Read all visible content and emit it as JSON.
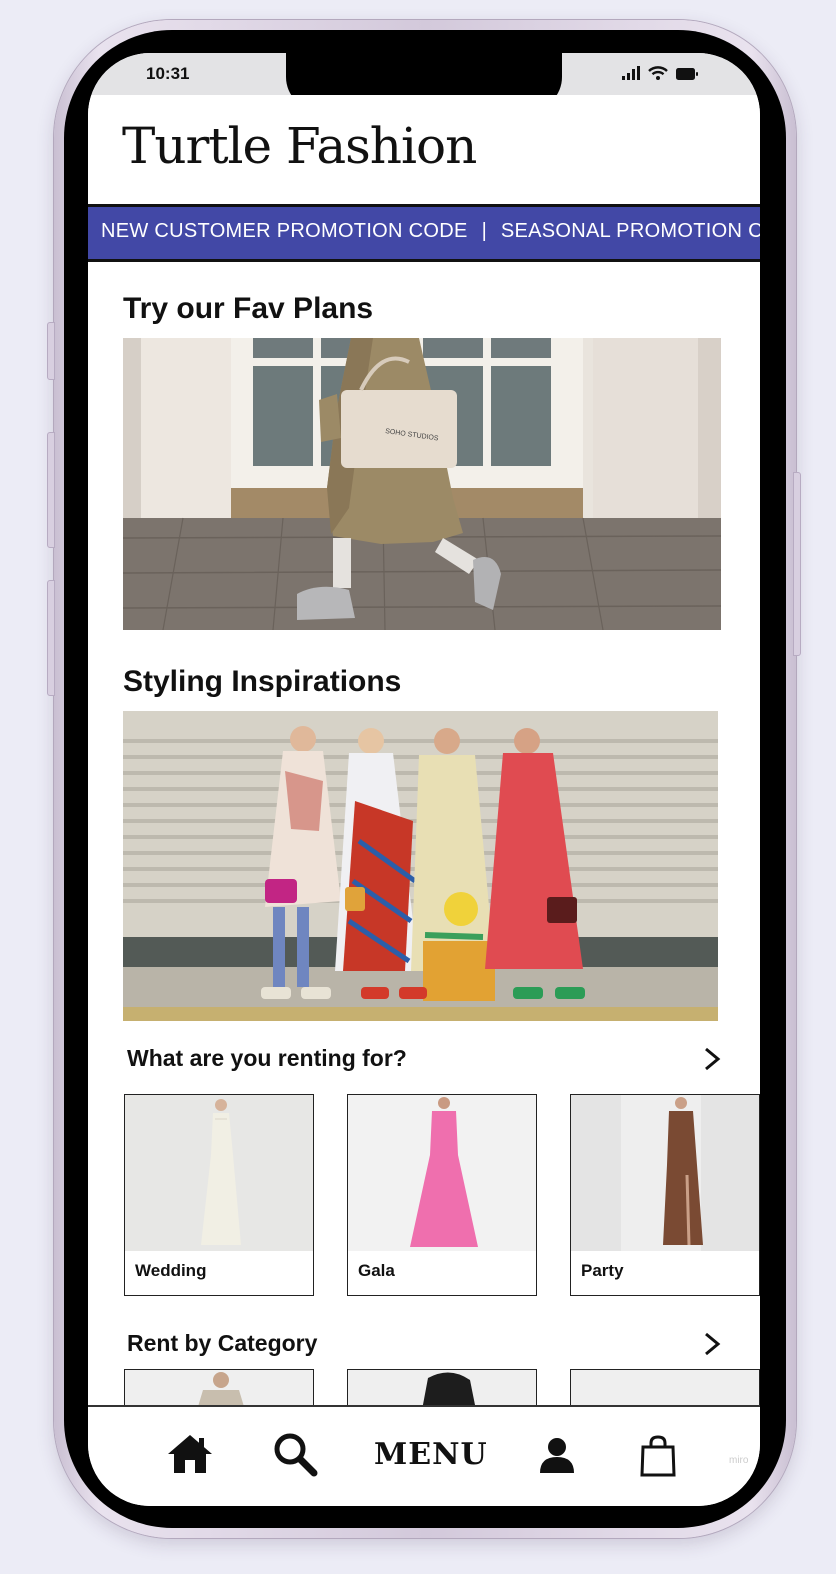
{
  "status_bar": {
    "time": "10:31"
  },
  "header": {
    "brand": "Turtle Fashion"
  },
  "promo": {
    "items": [
      "NEW CUSTOMER PROMOTION CODE",
      "SEASONAL PROMOTION CODE"
    ],
    "separator": "|"
  },
  "sections": {
    "fav_plans": {
      "title": "Try our Fav Plans"
    },
    "styling": {
      "title": "Styling Inspirations"
    }
  },
  "renting_for": {
    "title": "What are you renting for?",
    "cards": [
      {
        "label": "Wedding",
        "dress_color": "#f1efe4"
      },
      {
        "label": "Gala",
        "dress_color": "#ef6fae"
      },
      {
        "label": "Party",
        "dress_color": "#7a4a33"
      }
    ]
  },
  "rent_by_category": {
    "title": "Rent by Category"
  },
  "bottom_nav": {
    "items": [
      {
        "icon": "home-icon"
      },
      {
        "icon": "search-icon"
      },
      {
        "label": "MENU"
      },
      {
        "icon": "user-icon"
      },
      {
        "icon": "shopping-bag-icon"
      }
    ]
  },
  "watermark": "miro",
  "colors": {
    "promo_bar": "#4248a6",
    "background": "#ececf6"
  }
}
